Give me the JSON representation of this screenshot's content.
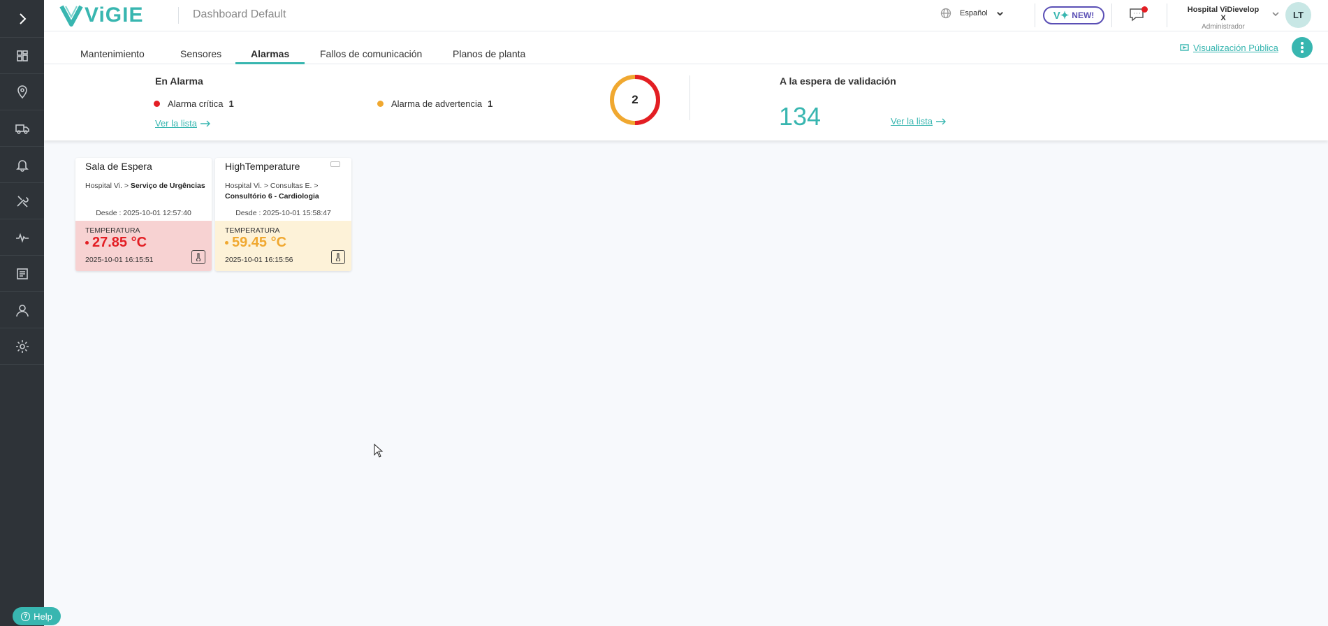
{
  "header": {
    "brand": "ViGIE",
    "dashboard_title": "Dashboard Default",
    "language": "Español",
    "new_badge": "NEW!",
    "user_name": "Hospital ViDievelop X",
    "user_role": "Administrador",
    "avatar_initials": "LT"
  },
  "sidebar": {
    "items": [
      "expand",
      "dashboard",
      "locations",
      "logistics",
      "alarms",
      "maintenance",
      "activity",
      "reports",
      "users",
      "settings"
    ]
  },
  "tabs": [
    {
      "label": "Mantenimiento"
    },
    {
      "label": "Sensores"
    },
    {
      "label": "Alarmas",
      "active": true
    },
    {
      "label": "Fallos de comunicación"
    },
    {
      "label": "Planos de planta"
    }
  ],
  "actions": {
    "public_view": "Visualización Pública"
  },
  "summary": {
    "in_alarm_title": "En Alarma",
    "critical_label": "Alarma crítica",
    "critical_count": "1",
    "warning_label": "Alarma de advertencia",
    "warning_count": "1",
    "see_list": "Ver la lista",
    "donut_total": "2",
    "awaiting_title": "A la espera de validación",
    "awaiting_count": "134",
    "see_list_2": "Ver la lista"
  },
  "cards": [
    {
      "title": "Sala de Espera",
      "path_prefix": "Hospital Vi. > ",
      "path_bold": "Serviço de Urgências",
      "since": "Desde : 2025-10-01 12:57:40",
      "type": "TEMPERATURA",
      "value": "27.85 °C",
      "timestamp": "2025-10-01 16:15:51",
      "level": "critical"
    },
    {
      "title": "HighTemperature",
      "path_prefix": "Hospital Vi. > Consultas E. > ",
      "path_bold": "Consultório 6 - Cardiologia",
      "since": "Desde : 2025-10-01 15:58:47",
      "type": "TEMPERATURA",
      "value": "59.45 °C",
      "timestamp": "2025-10-01 16:15:56",
      "level": "warning"
    }
  ],
  "help": {
    "label": "Help"
  },
  "colors": {
    "accent": "#38b6b0",
    "critical": "#e31e24",
    "warning": "#f0a830",
    "sidebar": "#2e3338"
  }
}
